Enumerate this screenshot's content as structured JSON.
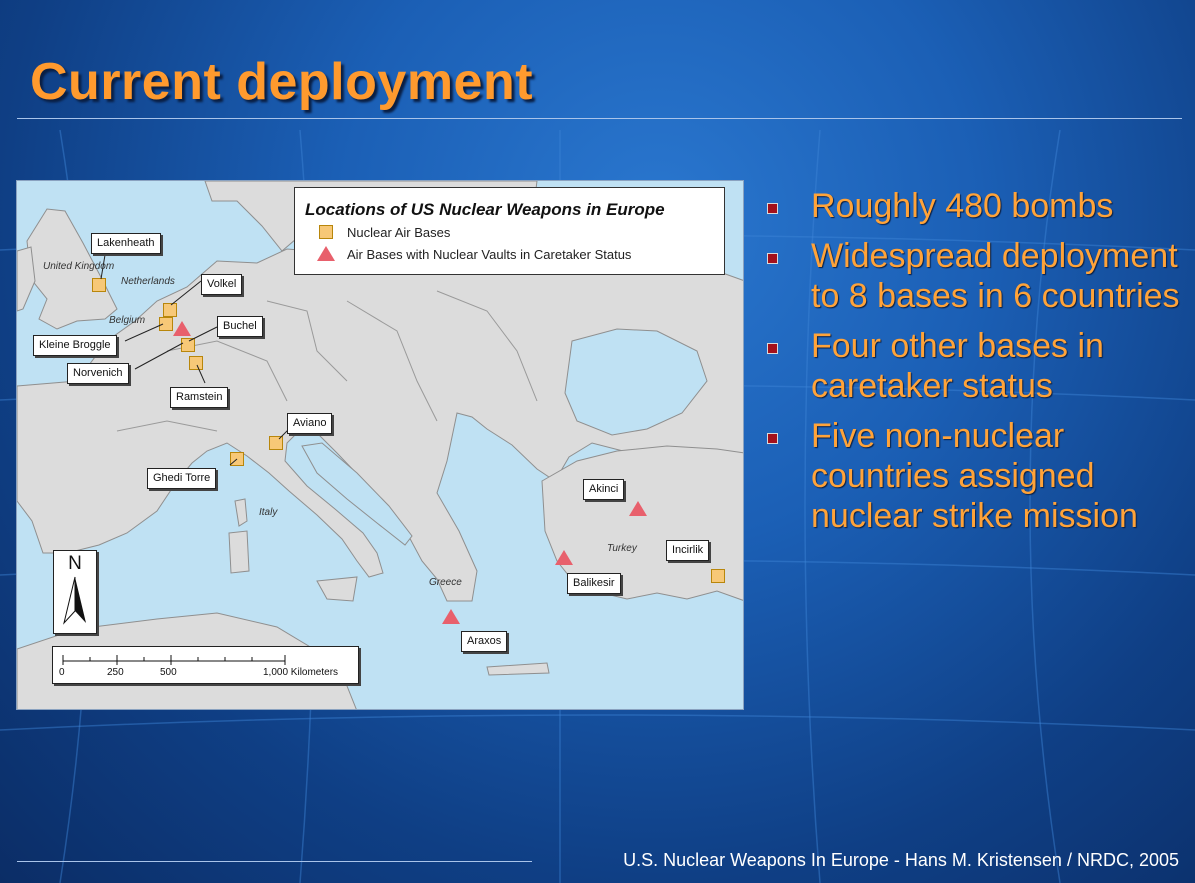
{
  "slide": {
    "title": "Current deployment",
    "footer": "U.S. Nuclear Weapons In Europe - Hans M. Kristensen / NRDC, 2005"
  },
  "map": {
    "legend": {
      "title": "Locations of US Nuclear Weapons in Europe",
      "nuclear_air_bases": "Nuclear Air Bases",
      "caretaker_bases": "Air Bases with Nuclear Vaults in Caretaker Status"
    },
    "bases": {
      "lakenheath": "Lakenheath",
      "volkel": "Volkel",
      "kleine_brogel": "Kleine Broggle",
      "buchel": "Buchel",
      "norvenich": "Norvenich",
      "ramstein": "Ramstein",
      "aviano": "Aviano",
      "ghedi_torre": "Ghedi Torre",
      "akinci": "Akinci",
      "incirlik": "Incirlik",
      "balikesir": "Balikesir",
      "araxos": "Araxos"
    },
    "countries": {
      "uk": "United Kingdom",
      "netherlands": "Netherlands",
      "belgium": "Belgium",
      "italy": "Italy",
      "greece": "Greece",
      "turkey": "Turkey"
    },
    "north": "N",
    "scale": [
      "0",
      "250",
      "500",
      "1,000 Kilometers"
    ]
  },
  "bullets": [
    "Roughly 480 bombs",
    "Widespread deployment to 8 bases in 6 countries",
    "Four other bases in caretaker status",
    "Five non-nuclear countries assigned nuclear strike mission"
  ],
  "colors": {
    "title": "#ff9a2e",
    "bullet_text": "#ffa339",
    "bullet_marker": "#a3101b",
    "sea": "#bfe1f3",
    "land": "#dcdcdc",
    "nuclear_base_marker": "#f7c877",
    "caretaker_marker": "#e8606c"
  }
}
